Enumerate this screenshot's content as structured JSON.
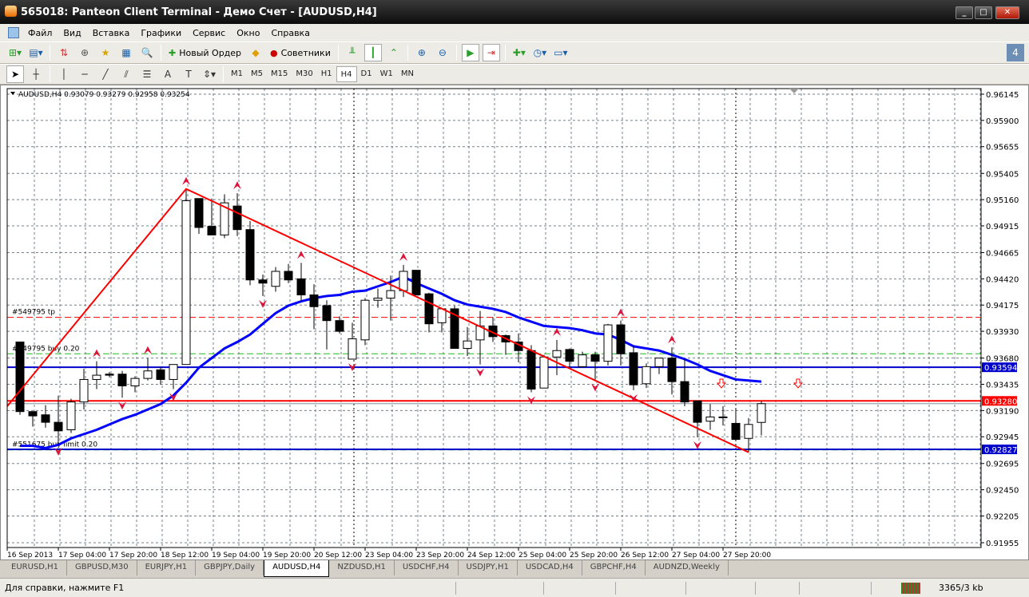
{
  "window": {
    "title": "565018: Panteon Client Terminal - Демо Счет - [AUDUSD,H4]"
  },
  "menu": [
    "Файл",
    "Вид",
    "Вставка",
    "Графики",
    "Сервис",
    "Окно",
    "Справка"
  ],
  "toolbar": {
    "new_order": "Новый Ордер",
    "experts": "Советники"
  },
  "timeframes": [
    "M1",
    "M5",
    "M15",
    "M30",
    "H1",
    "H4",
    "D1",
    "W1",
    "MN"
  ],
  "active_timeframe": "H4",
  "tabs": [
    "EURUSD,H1",
    "GBPUSD,M30",
    "EURJPY,H1",
    "GBPJPY,Daily",
    "AUDUSD,H4",
    "NZDUSD,H1",
    "USDCHF,H4",
    "USDJPY,H1",
    "USDCAD,H4",
    "GBPCHF,H4",
    "AUDNZD,Weekly"
  ],
  "active_tab": "AUDUSD,H4",
  "status": {
    "help": "Для справки, нажмите F1",
    "traffic": "3365/3 kb"
  },
  "colors": {
    "bull": "#ffffff",
    "bear": "#000000",
    "ma": "#0000ff",
    "zigzag": "#ff0000",
    "fractal": "#dc143c",
    "grid": "#708090"
  },
  "chart_data": {
    "type": "candlestick",
    "title": "AUDUSD,H4  0.93079 0.93279 0.92958 0.93254",
    "ylim": [
      0.9183,
      0.9623
    ],
    "y_ticks": [
      "0.96145",
      "0.95900",
      "0.95655",
      "0.95405",
      "0.95160",
      "0.94915",
      "0.94665",
      "0.94420",
      "0.94175",
      "0.93930",
      "0.93680",
      "0.93435",
      "0.93190",
      "0.92945",
      "0.92695",
      "0.92450",
      "0.92205",
      "0.91955"
    ],
    "x_labels": [
      "16 Sep 2013",
      "17 Sep 04:00",
      "17 Sep 20:00",
      "18 Sep 12:00",
      "19 Sep 04:00",
      "19 Sep 20:00",
      "20 Sep 12:00",
      "23 Sep 04:00",
      "23 Sep 20:00",
      "24 Sep 12:00",
      "25 Sep 04:00",
      "25 Sep 20:00",
      "26 Sep 12:00",
      "27 Sep 04:00",
      "27 Sep 20:00"
    ],
    "ohlc": [
      [
        0.9383,
        0.9383,
        0.9315,
        0.9318
      ],
      [
        0.9318,
        0.9318,
        0.9304,
        0.9314
      ],
      [
        0.9315,
        0.9324,
        0.9303,
        0.9308
      ],
      [
        0.9308,
        0.9333,
        0.9288,
        0.93
      ],
      [
        0.9301,
        0.933,
        0.9298,
        0.9327
      ],
      [
        0.9327,
        0.9358,
        0.932,
        0.9348
      ],
      [
        0.9348,
        0.9365,
        0.9339,
        0.9352
      ],
      [
        0.9353,
        0.9355,
        0.935,
        0.9352
      ],
      [
        0.9353,
        0.9356,
        0.9331,
        0.9342
      ],
      [
        0.9342,
        0.9351,
        0.9336,
        0.9349
      ],
      [
        0.9349,
        0.9368,
        0.9347,
        0.9356
      ],
      [
        0.9357,
        0.936,
        0.9343,
        0.9348
      ],
      [
        0.9348,
        0.9362,
        0.9339,
        0.9362
      ],
      [
        0.9362,
        0.9526,
        0.9362,
        0.9515
      ],
      [
        0.9517,
        0.9517,
        0.9484,
        0.949
      ],
      [
        0.9491,
        0.9517,
        0.9483,
        0.9483
      ],
      [
        0.9483,
        0.9521,
        0.948,
        0.9513
      ],
      [
        0.951,
        0.9522,
        0.9482,
        0.9488
      ],
      [
        0.9488,
        0.9496,
        0.9436,
        0.9441
      ],
      [
        0.9441,
        0.9446,
        0.9426,
        0.9438
      ],
      [
        0.9435,
        0.9453,
        0.943,
        0.9449
      ],
      [
        0.9449,
        0.9456,
        0.9438,
        0.9441
      ],
      [
        0.9442,
        0.9457,
        0.9421,
        0.9427
      ],
      [
        0.9427,
        0.9437,
        0.9395,
        0.9416
      ],
      [
        0.9417,
        0.9422,
        0.9376,
        0.9403
      ],
      [
        0.9403,
        0.9407,
        0.9391,
        0.9393
      ],
      [
        0.9367,
        0.9401,
        0.9367,
        0.9386
      ],
      [
        0.9385,
        0.9424,
        0.938,
        0.9422
      ],
      [
        0.9422,
        0.9433,
        0.9415,
        0.9424
      ],
      [
        0.9424,
        0.9445,
        0.9403,
        0.9431
      ],
      [
        0.9431,
        0.9455,
        0.9425,
        0.9449
      ],
      [
        0.945,
        0.945,
        0.9427,
        0.9427
      ],
      [
        0.9428,
        0.9429,
        0.9392,
        0.94
      ],
      [
        0.9401,
        0.9415,
        0.9392,
        0.9414
      ],
      [
        0.9414,
        0.9417,
        0.9377,
        0.9377
      ],
      [
        0.9377,
        0.9397,
        0.937,
        0.9384
      ],
      [
        0.9385,
        0.9412,
        0.9362,
        0.9398
      ],
      [
        0.9398,
        0.9406,
        0.9383,
        0.9388
      ],
      [
        0.9389,
        0.939,
        0.9371,
        0.9383
      ],
      [
        0.9383,
        0.9391,
        0.9364,
        0.9375
      ],
      [
        0.9375,
        0.938,
        0.9336,
        0.9339
      ],
      [
        0.934,
        0.9371,
        0.934,
        0.9369
      ],
      [
        0.9369,
        0.9385,
        0.9352,
        0.9375
      ],
      [
        0.9376,
        0.9377,
        0.9359,
        0.9365
      ],
      [
        0.936,
        0.9374,
        0.9359,
        0.9371
      ],
      [
        0.9371,
        0.9374,
        0.9348,
        0.9365
      ],
      [
        0.9365,
        0.94,
        0.9361,
        0.9399
      ],
      [
        0.9399,
        0.9403,
        0.9361,
        0.9372
      ],
      [
        0.9373,
        0.9379,
        0.9338,
        0.9343
      ],
      [
        0.9344,
        0.9363,
        0.934,
        0.936
      ],
      [
        0.936,
        0.9368,
        0.9353,
        0.9368
      ],
      [
        0.9368,
        0.9378,
        0.9334,
        0.9346
      ],
      [
        0.9346,
        0.9367,
        0.9323,
        0.9327
      ],
      [
        0.9328,
        0.9328,
        0.9294,
        0.9308
      ],
      [
        0.9309,
        0.9325,
        0.9301,
        0.9313
      ],
      [
        0.9313,
        0.9323,
        0.9305,
        0.9313
      ],
      [
        0.9307,
        0.9321,
        0.9292,
        0.9292
      ],
      [
        0.9293,
        0.9312,
        0.928,
        0.9306
      ],
      [
        0.93079,
        0.93279,
        0.92958,
        0.93254
      ]
    ],
    "ma": [
      0.9286,
      0.9286,
      0.9284,
      0.9287,
      0.9293,
      0.9297,
      0.9301,
      0.9306,
      0.9311,
      0.9315,
      0.932,
      0.9325,
      0.9333,
      0.9345,
      0.9359,
      0.9368,
      0.9377,
      0.9383,
      0.939,
      0.94,
      0.941,
      0.9417,
      0.9421,
      0.9424,
      0.9426,
      0.9427,
      0.943,
      0.9431,
      0.9435,
      0.9439,
      0.9444,
      0.9438,
      0.9433,
      0.9428,
      0.9422,
      0.9418,
      0.9416,
      0.9414,
      0.9411,
      0.9406,
      0.9402,
      0.9398,
      0.9397,
      0.9396,
      0.9394,
      0.9391,
      0.939,
      0.9385,
      0.9379,
      0.9377,
      0.9375,
      0.9371,
      0.9367,
      0.9362,
      0.9356,
      0.9352,
      0.9348,
      0.9347,
      0.9346
    ],
    "zigzag": [
      {
        "i": -1,
        "price": 0.9323
      },
      {
        "i": 13,
        "price": 0.9526
      },
      {
        "i": 57,
        "price": 0.928
      }
    ],
    "fractals_up": [
      6,
      10,
      13,
      17,
      22,
      30,
      42,
      47,
      51
    ],
    "fractals_down": [
      3,
      8,
      12,
      19,
      26,
      36,
      40,
      45,
      48,
      53
    ],
    "hlines": [
      {
        "price": 0.93594,
        "label": "0.93594",
        "color": "#0000cc"
      },
      {
        "price": 0.9328,
        "label": "0.93280",
        "color": "#ff0000"
      },
      {
        "price": 0.92827,
        "label": "0.92827",
        "color": "#0000cc"
      }
    ],
    "orders": [
      {
        "price": 0.9406,
        "label": "#549795 tp",
        "color": "#ff0000"
      },
      {
        "price": 0.9372,
        "label": "#549795 buy 0.20",
        "color": "#22bb22"
      },
      {
        "price": 0.92822,
        "label": "#551675 buy limit 0.20",
        "color": "#22bb22"
      }
    ],
    "bid": 0.93254,
    "signal_arrows_down": [
      55,
      61
    ]
  }
}
